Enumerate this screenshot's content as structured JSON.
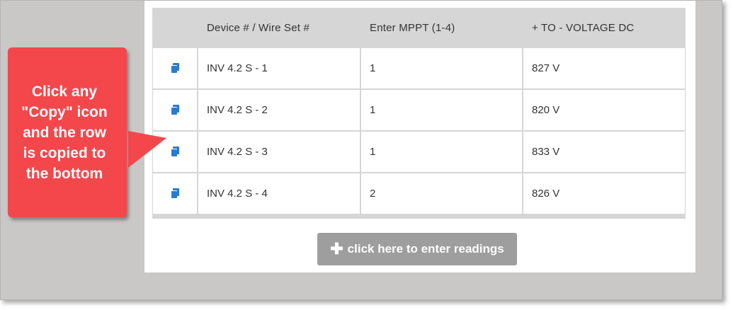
{
  "table": {
    "headers": [
      "",
      "Device # / Wire Set #",
      "Enter MPPT (1-4)",
      "+ TO - VOLTAGE DC"
    ],
    "rows": [
      {
        "device": "INV 4.2 S - 1",
        "mppt": "1",
        "voltage": "827 V"
      },
      {
        "device": "INV 4.2 S - 2",
        "mppt": "1",
        "voltage": "820 V"
      },
      {
        "device": "INV 4.2 S - 3",
        "mppt": "1",
        "voltage": "833 V"
      },
      {
        "device": "INV 4.2 S - 4",
        "mppt": "2",
        "voltage": "826 V"
      }
    ]
  },
  "add_button": {
    "icon": "plus-icon",
    "label": "click here to enter readings"
  },
  "callout": {
    "text_lines": [
      "Click any",
      "\"Copy\" icon",
      "and the row",
      "is copied to",
      "the bottom"
    ]
  },
  "colors": {
    "copy_icon": "#2a7ad1",
    "callout": "#f4474c",
    "button": "#9e9e9e",
    "header": "#d6d6d6"
  }
}
